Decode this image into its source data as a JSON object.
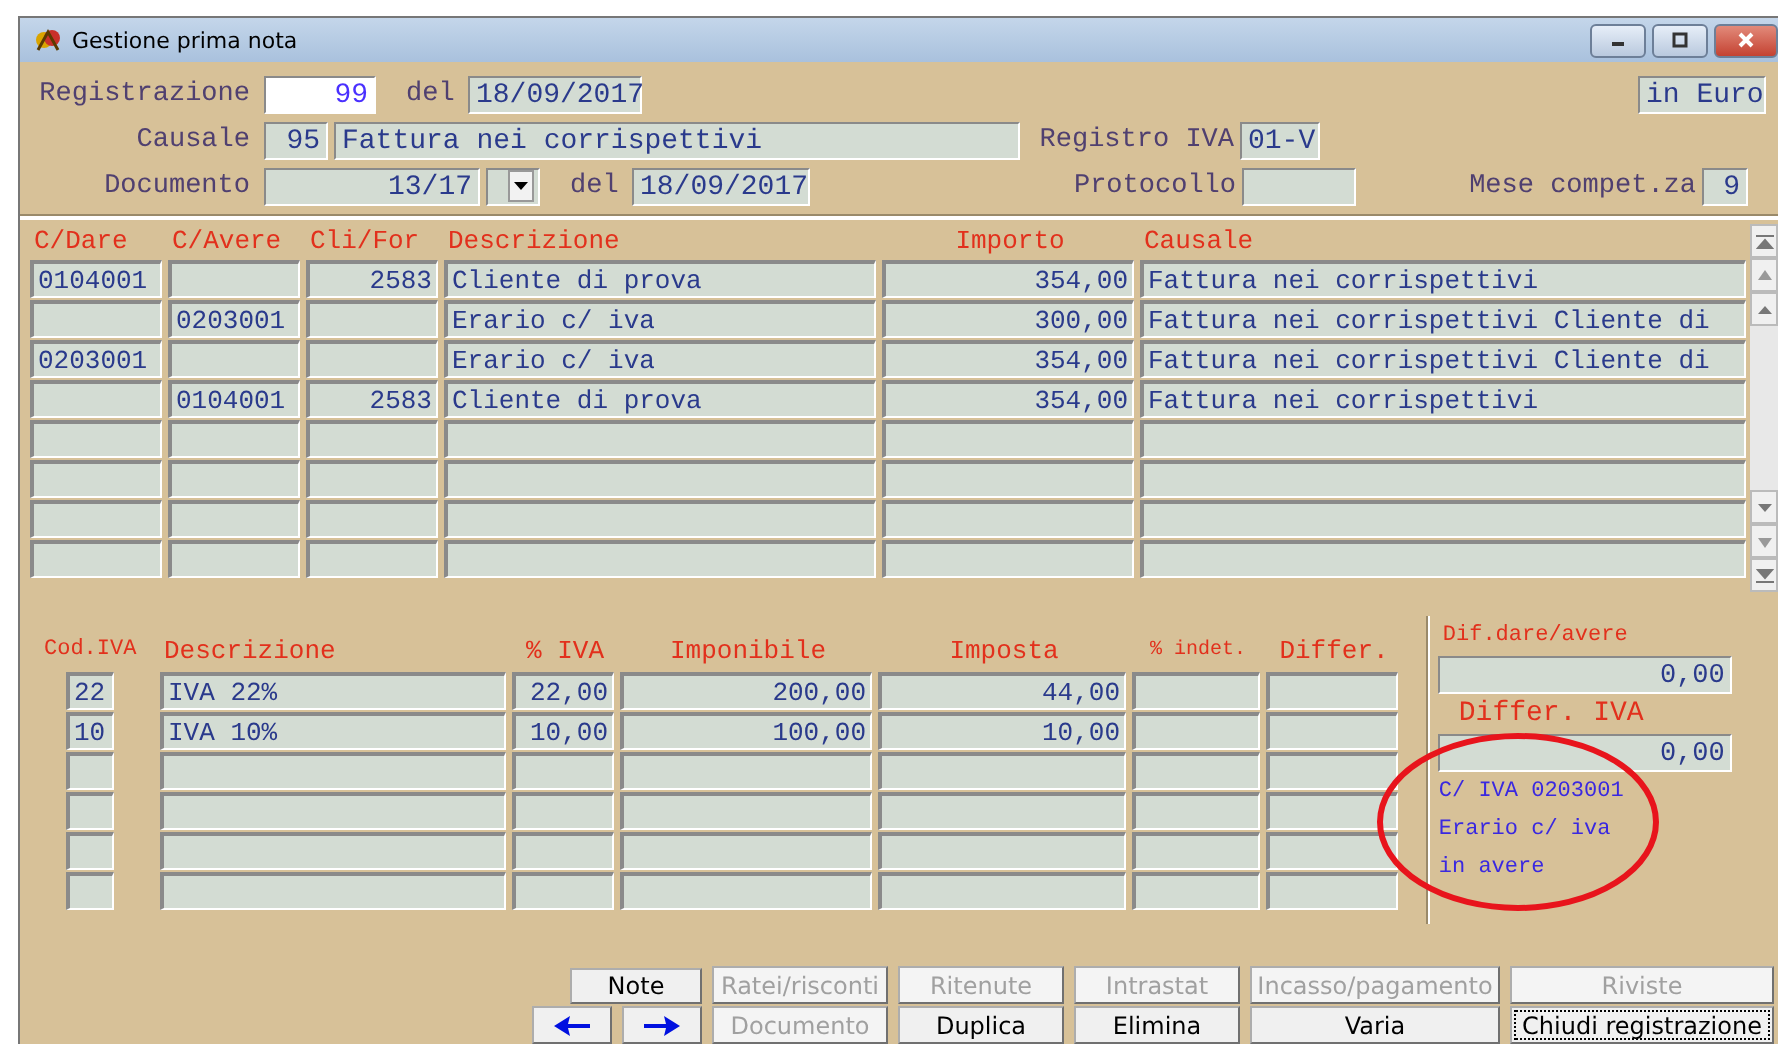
{
  "window": {
    "title": "Gestione prima nota"
  },
  "header": {
    "registrazione_label": "Registrazione",
    "registrazione": "99",
    "del_label": "del",
    "data_registrazione": "18/09/2017",
    "currency": "in Euro",
    "causale_label": "Causale",
    "causale_code": "95",
    "causale_desc": "Fattura nei corrispettivi",
    "registro_iva_label": "Registro IVA",
    "registro_iva": "01-V",
    "documento_label": "Documento",
    "documento": "13/17",
    "doc_del_label": "del",
    "data_documento": "18/09/2017",
    "protocollo_label": "Protocollo",
    "mese_label": "Mese compet.za",
    "mese": "9"
  },
  "movements": {
    "columns": [
      "C/Dare",
      "C/Avere",
      "Cli/For",
      "Descrizione",
      "Importo",
      "Causale"
    ],
    "rows": [
      {
        "c_dare": "0104001",
        "cli_for": "2583",
        "descrizione": "Cliente di prova",
        "importo": "354,00",
        "causale": "Fattura nei corrispettivi"
      },
      {
        "c_avere": "0203001",
        "descrizione": "Erario c/ iva",
        "importo": "300,00",
        "causale": "Fattura nei corrispettivi Cliente di"
      },
      {
        "c_dare": "0203001",
        "descrizione": "Erario c/ iva",
        "importo": "354,00",
        "causale": "Fattura nei corrispettivi Cliente di"
      },
      {
        "c_avere": "0104001",
        "cli_for": "2583",
        "descrizione": "Cliente di prova",
        "importo": "354,00",
        "causale": "Fattura nei corrispettivi"
      },
      {},
      {},
      {},
      {}
    ]
  },
  "vat": {
    "columns": [
      "Cod.IVA",
      "Descrizione",
      "% IVA",
      "Imponibile",
      "Imposta",
      "% indet.",
      "Differ."
    ],
    "rows": [
      {
        "cod_iva": "22",
        "descrizione": "IVA 22%",
        "perc_iva": "22,00",
        "imponibile": "200,00",
        "imposta": "44,00"
      },
      {
        "cod_iva": "10",
        "descrizione": "IVA 10%",
        "perc_iva": "10,00",
        "imponibile": "100,00",
        "imposta": "10,00"
      },
      {},
      {},
      {},
      {}
    ]
  },
  "summary": {
    "dif_label": "Dif.dare/avere",
    "dif_value": "0,00",
    "differ_iva_label": "Differ. IVA",
    "differ_iva_value": "0,00",
    "note_lines": [
      "C/ IVA 0203001",
      "Erario c/ iva",
      "in avere"
    ]
  },
  "buttons_row_1": [
    {
      "label": "Note",
      "disabled": false
    },
    {
      "label": "Ratei/risconti",
      "disabled": true
    },
    {
      "label": "Ritenute",
      "disabled": true
    },
    {
      "label": "Intrastat",
      "disabled": true
    },
    {
      "label": "Incasso/pagamento",
      "disabled": true
    },
    {
      "label": "Riviste",
      "disabled": true
    }
  ],
  "buttons_row_2": [
    {
      "kind": "prev",
      "disabled": false
    },
    {
      "kind": "next",
      "disabled": false
    },
    {
      "label": "Documento",
      "disabled": true
    },
    {
      "label": "Duplica",
      "disabled": false
    },
    {
      "label": "Elimina",
      "disabled": false
    },
    {
      "label": "Varia",
      "disabled": false
    },
    {
      "label": "Chiudi registrazione",
      "disabled": false,
      "focused": true
    }
  ]
}
